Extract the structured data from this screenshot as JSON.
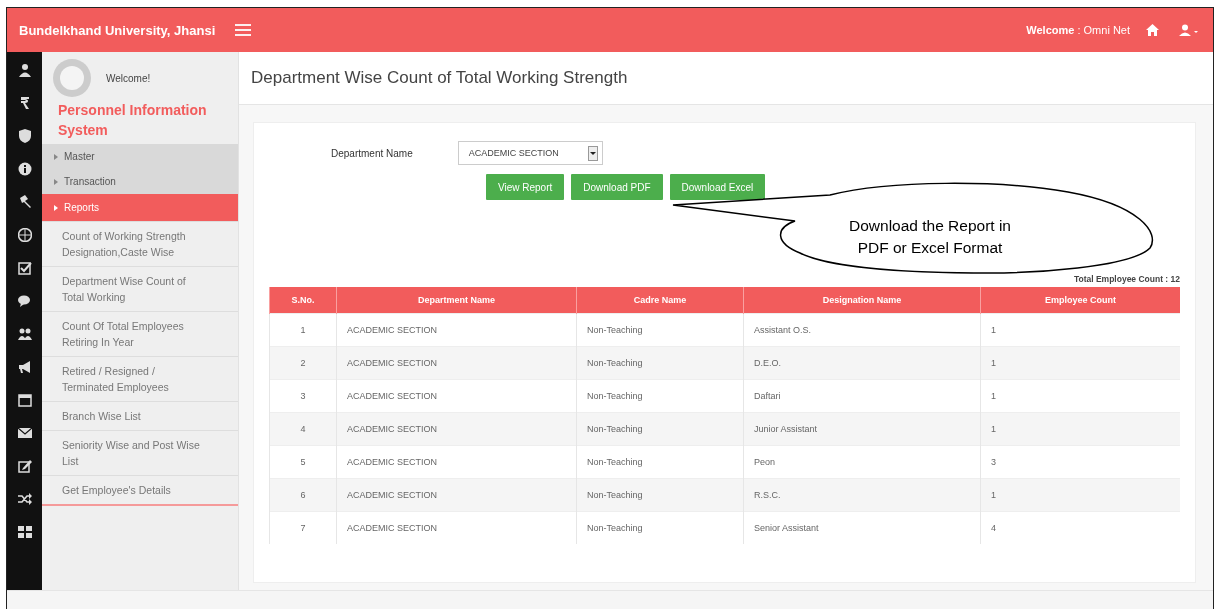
{
  "header": {
    "title": "Bundelkhand University, Jhansi",
    "welcome": "**Welcome** : Omni Net"
  },
  "profile": {
    "greeting": "Welcome!",
    "system_name": "Personnel Information System"
  },
  "menu": [
    {
      "label": "Master",
      "selected": false
    },
    {
      "label": "Transaction",
      "selected": false
    },
    {
      "label": "Reports",
      "selected": true
    }
  ],
  "submenu": [
    "Count of Working Strength Designation,Caste Wise",
    "Department Wise Count of Total Working",
    "Count Of Total Employees Retiring In Year",
    "Retired / Resigned / Terminated Employees",
    "Branch Wise List",
    "Seniority Wise and Post Wise List",
    "Get Employee's Details"
  ],
  "page_title": "Department Wise Count of Total Working Strength",
  "filter": {
    "label": "Department Name",
    "value": "ACADEMIC SECTION"
  },
  "buttons": [
    "View Report",
    "Download PDF",
    "Download Excel"
  ],
  "callout": "Download the Report in PDF or Excel Format",
  "total": "Total Employee Count : 12",
  "table": {
    "columns": [
      "S.No.",
      "Department Name",
      "Cadre Name",
      "Designation Name",
      "Employee Count"
    ],
    "rows": [
      [
        "1",
        "ACADEMIC SECTION",
        "Non-Teaching",
        "Assistant O.S.",
        "1"
      ],
      [
        "2",
        "ACADEMIC SECTION",
        "Non-Teaching",
        "D.E.O.",
        "1"
      ],
      [
        "3",
        "ACADEMIC SECTION",
        "Non-Teaching",
        "Daftari",
        "1"
      ],
      [
        "4",
        "ACADEMIC SECTION",
        "Non-Teaching",
        "Junior Assistant",
        "1"
      ],
      [
        "5",
        "ACADEMIC SECTION",
        "Non-Teaching",
        "Peon",
        "3"
      ],
      [
        "6",
        "ACADEMIC SECTION",
        "Non-Teaching",
        "R.S.C.",
        "1"
      ],
      [
        "7",
        "ACADEMIC SECTION",
        "Non-Teaching",
        "Senior Assistant",
        "4"
      ]
    ]
  }
}
